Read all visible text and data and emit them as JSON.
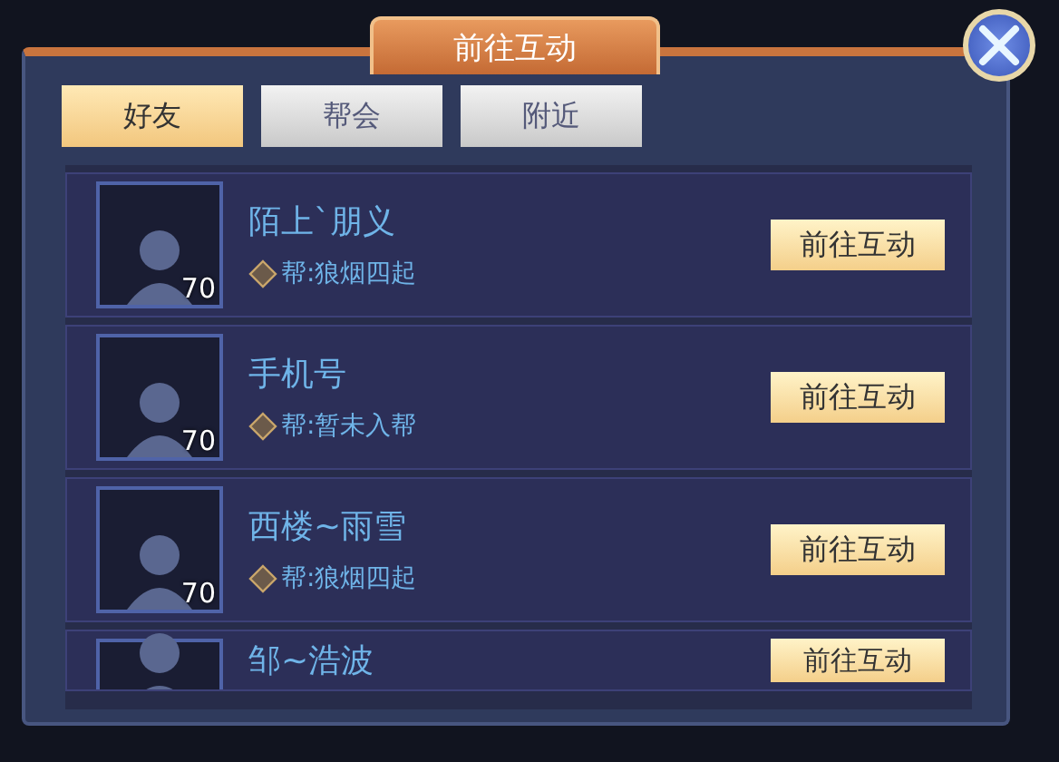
{
  "window": {
    "title": "前往互动"
  },
  "tabs": [
    {
      "label": "好友",
      "selected": true
    },
    {
      "label": "帮会",
      "selected": false
    },
    {
      "label": "附近",
      "selected": false
    }
  ],
  "friends": [
    {
      "name": "陌上`朋义",
      "level": "70",
      "guild": "帮:狼烟四起",
      "action": "前往互动"
    },
    {
      "name": "手机号",
      "level": "70",
      "guild": "帮:暂未入帮",
      "action": "前往互动"
    },
    {
      "name": "西楼~雨雪",
      "level": "70",
      "guild": "帮:狼烟四起",
      "action": "前往互动"
    },
    {
      "name": "邹~浩波",
      "action": "前往互动"
    }
  ]
}
